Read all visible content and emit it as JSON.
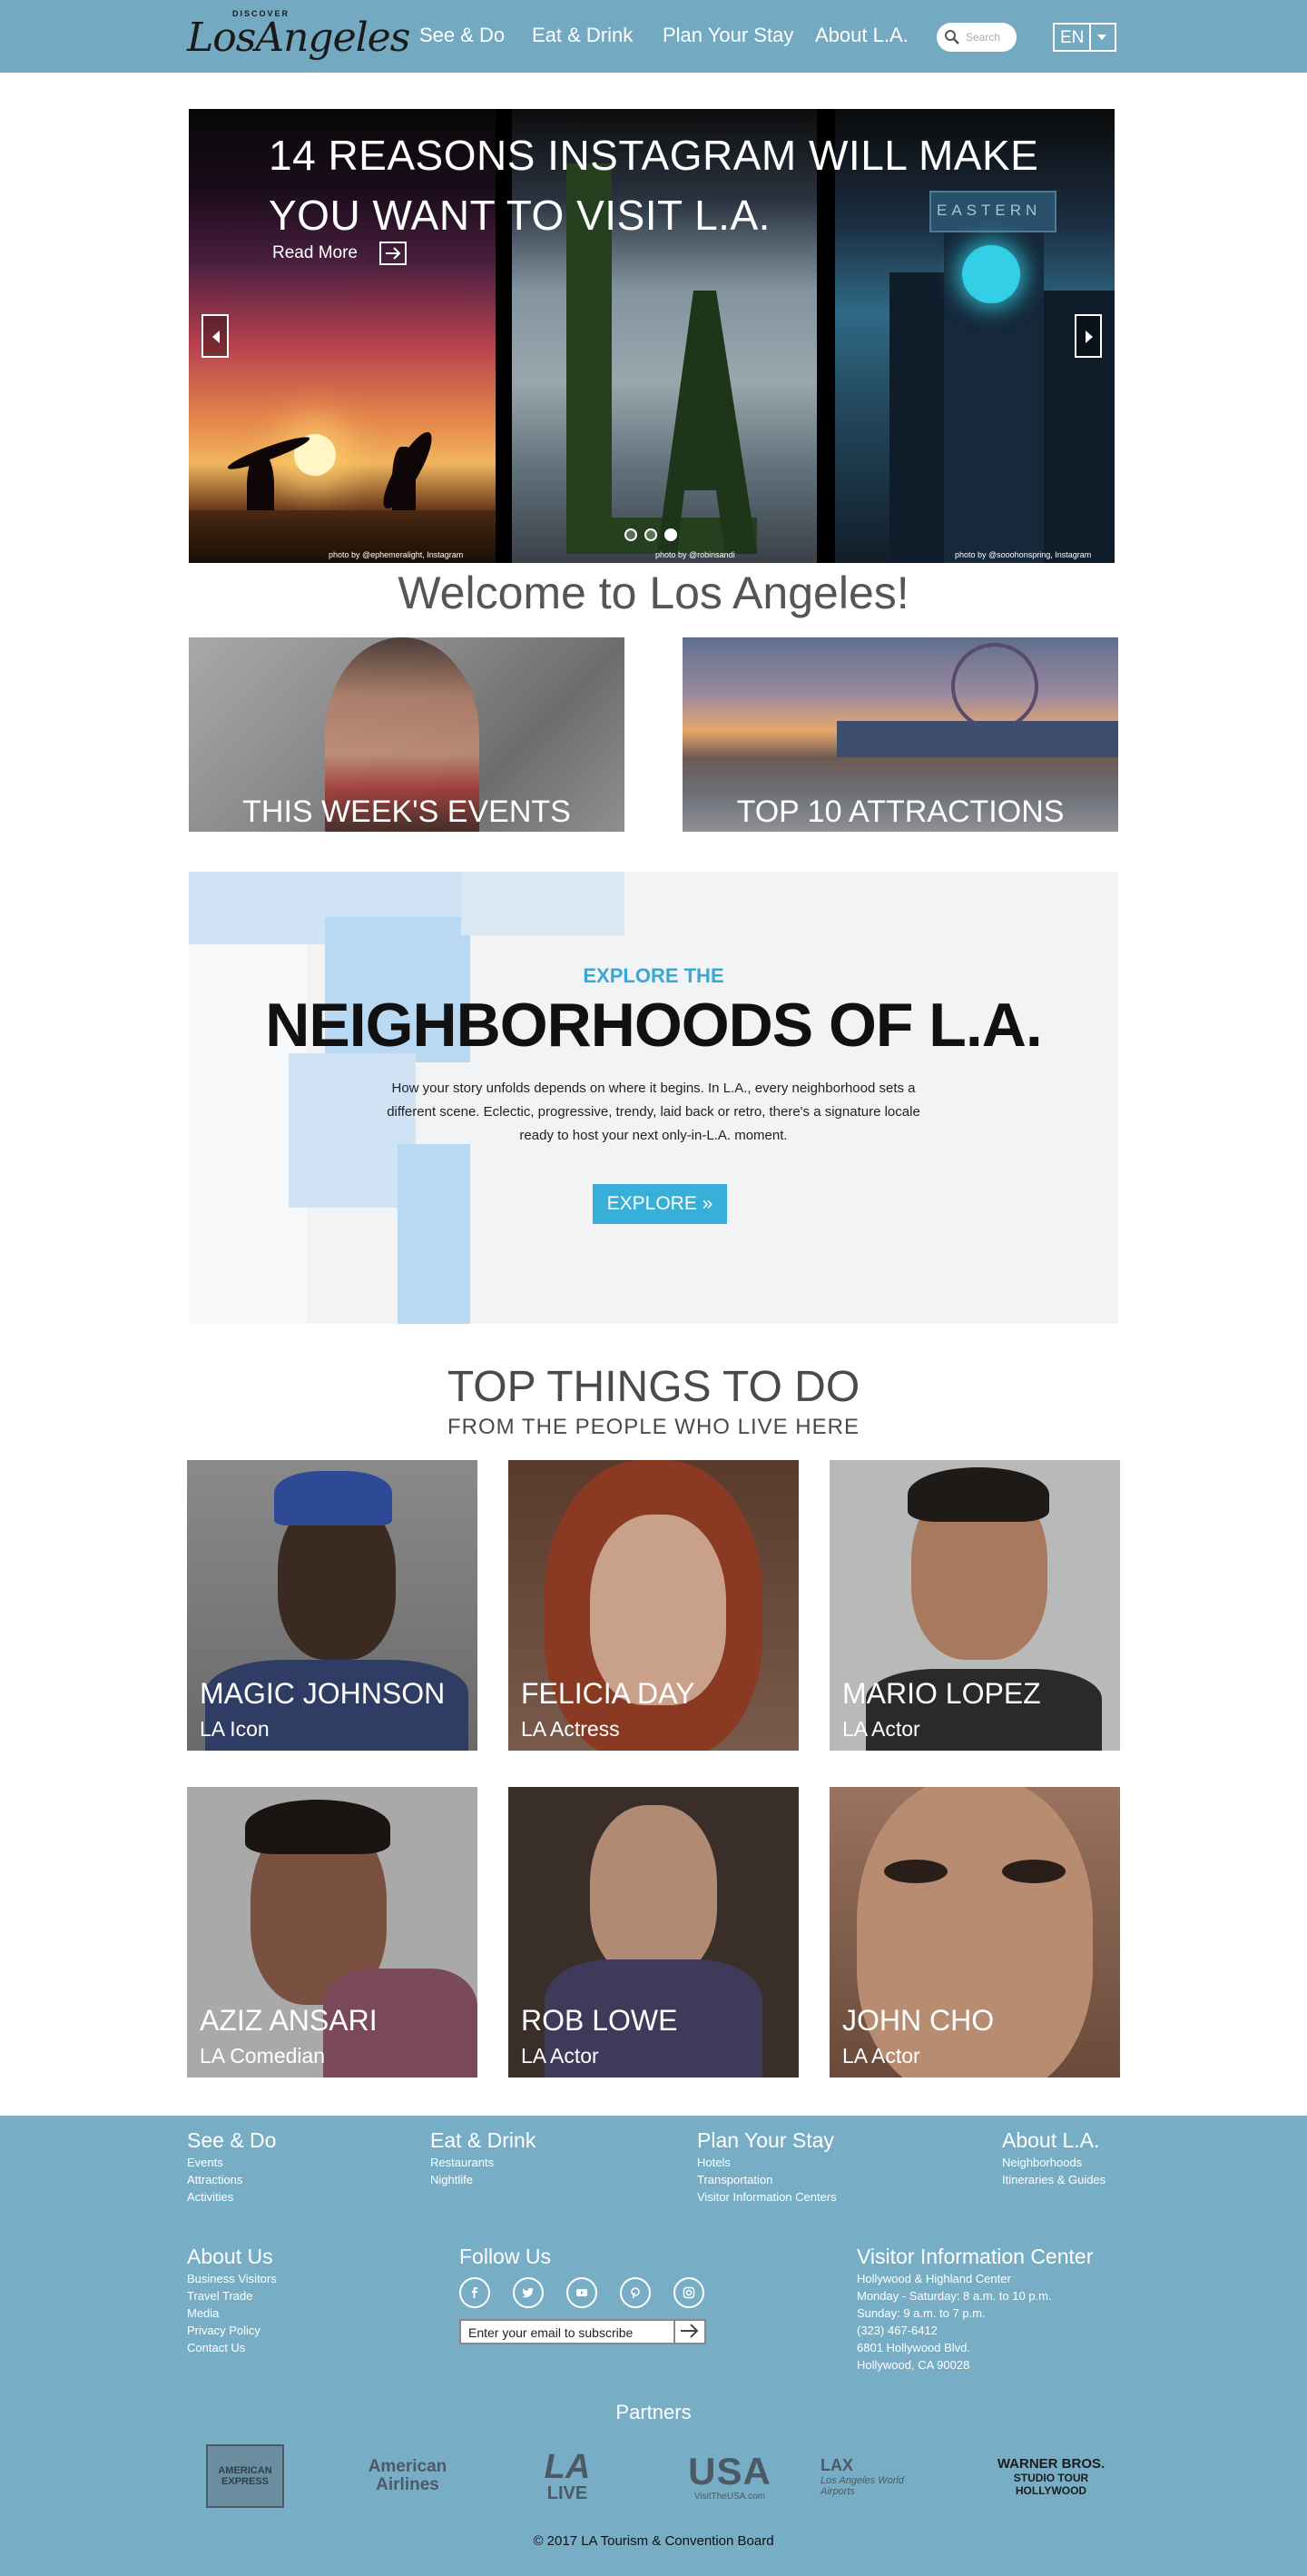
{
  "header": {
    "logo_small": "DISCOVER",
    "logo_main": "LosAngeles",
    "nav": [
      "See & Do",
      "Eat & Drink",
      "Plan Your Stay",
      "About L.A."
    ],
    "search_placeholder": "Search",
    "lang": "EN",
    "bg_color": "#74a9c2"
  },
  "hero": {
    "title": "14 REASONS INSTAGRAM WILL MAKE YOU WANT TO VISIT L.A.",
    "read_more": "Read More",
    "sign_text": "EASTERN",
    "credits": [
      "photo by @ephemeralight, Instagram",
      "photo by @robinsandi",
      "photo by @sooohonspring, Instagram"
    ],
    "dots": 3,
    "active_dot": 3
  },
  "welcome": "Welcome to Los Angeles!",
  "features": [
    {
      "label": "THIS WEEK'S EVENTS"
    },
    {
      "label": "TOP 10 ATTRACTIONS"
    }
  ],
  "neighborhoods": {
    "kicker": "EXPLORE THE",
    "title": "NEIGHBORHOODS OF L.A.",
    "description": "How your story unfolds depends on where it begins. In L.A., every neighborhood sets a different scene. Eclectic, progressive, trendy, laid back or retro, there's a signature locale ready to host your next only-in-L.A. moment.",
    "button": "EXPLORE »",
    "accent_color": "#36b0d9"
  },
  "top_things": {
    "title": "TOP THINGS TO DO",
    "subtitle": "FROM THE PEOPLE WHO LIVE HERE",
    "people": [
      {
        "name": "MAGIC JOHNSON",
        "role": "LA Icon"
      },
      {
        "name": "FELICIA DAY",
        "role": "LA Actress"
      },
      {
        "name": "MARIO LOPEZ",
        "role": "LA Actor"
      },
      {
        "name": "AZIZ ANSARI",
        "role": "LA Comedian"
      },
      {
        "name": "ROB LOWE",
        "role": "LA Actor"
      },
      {
        "name": "JOHN CHO",
        "role": "LA Actor"
      }
    ]
  },
  "footer": {
    "columns": [
      {
        "heading": "See & Do",
        "links": [
          "Events",
          "Attractions",
          "Activities"
        ]
      },
      {
        "heading": "Eat & Drink",
        "links": [
          "Restaurants",
          "Nightlife"
        ]
      },
      {
        "heading": "Plan Your Stay",
        "links": [
          "Hotels",
          "Transportation",
          "Visitor Information Centers"
        ]
      },
      {
        "heading": "About L.A.",
        "links": [
          "Neighborhoods",
          "Itineraries & Guides"
        ]
      }
    ],
    "about": {
      "heading": "About Us",
      "links": [
        "Business Visitors",
        "Travel Trade",
        "Media",
        "Privacy Policy",
        "Contact Us"
      ]
    },
    "follow": {
      "heading": "Follow Us",
      "icons": [
        "facebook-icon",
        "twitter-icon",
        "youtube-icon",
        "pinterest-icon",
        "instagram-icon"
      ],
      "subscribe_text": "Enter your email to subscribe"
    },
    "visitor": {
      "heading": "Visitor Information Center",
      "lines": [
        "Hollywood & Highland Center",
        "Monday - Saturday: 8 a.m. to 10 p.m.",
        "Sunday: 9 a.m. to 7 p.m.",
        "(323) 467-6412",
        "6801 Hollywood Blvd.",
        "Hollywood, CA 90028"
      ]
    },
    "partners_title": "Partners",
    "partners": [
      {
        "line1": "AMERICAN",
        "line2": "EXPRESS"
      },
      {
        "line1": "American",
        "line2": "Airlines"
      },
      {
        "line1": "LA",
        "line2": "LIVE"
      },
      {
        "line1": "USA",
        "line2": "VisitTheUSA.com"
      },
      {
        "line1": "LAX",
        "line2": "Los Angeles World Airports"
      },
      {
        "line1": "WARNER BROS.",
        "line2": "STUDIO TOUR HOLLYWOOD"
      }
    ],
    "copyright": "© 2017 LA Tourism & Convention Board",
    "bg_color": "#77aec6"
  }
}
